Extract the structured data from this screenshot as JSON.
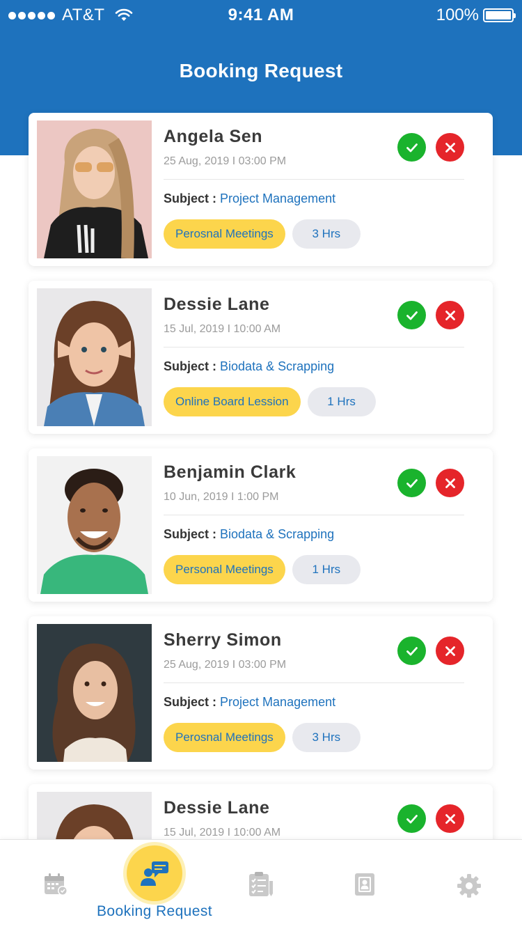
{
  "status_bar": {
    "carrier": "AT&T",
    "time": "9:41 AM",
    "battery": "100%"
  },
  "header": {
    "title": "Booking Request"
  },
  "colors": {
    "primary": "#1e72bd",
    "accept": "#1ab32d",
    "decline": "#e5252a",
    "tag_yellow": "#fcd54c",
    "tag_gray": "#e8e9ee"
  },
  "requests": [
    {
      "name": "Angela Sen",
      "datetime": "25 Aug, 2019 I 03:00 PM",
      "subject_label": "Subject :",
      "subject": "Project Management",
      "type": "Perosnal Meetings",
      "hours": "3 Hrs"
    },
    {
      "name": "Dessie Lane",
      "datetime": "15 Jul, 2019 I 10:00 AM",
      "subject_label": "Subject :",
      "subject": "Biodata & Scrapping",
      "type": "Online Board Lession",
      "hours": "1 Hrs"
    },
    {
      "name": "Benjamin Clark",
      "datetime": "10 Jun, 2019 I 1:00 PM",
      "subject_label": "Subject :",
      "subject": "Biodata & Scrapping",
      "type": "Personal Meetings",
      "hours": "1 Hrs"
    },
    {
      "name": "Sherry Simon",
      "datetime": "25 Aug, 2019 I 03:00 PM",
      "subject_label": "Subject :",
      "subject": "Project Management",
      "type": "Perosnal Meetings",
      "hours": "3 Hrs"
    },
    {
      "name": "Dessie Lane",
      "datetime": "15 Jul, 2019 I 10:00 AM"
    }
  ],
  "tab_bar": {
    "items": [
      {
        "icon": "calendar-icon"
      },
      {
        "icon": "booking-request-icon",
        "label": "Booking Request",
        "active": true
      },
      {
        "icon": "checklist-icon"
      },
      {
        "icon": "contact-book-icon"
      },
      {
        "icon": "gear-icon"
      }
    ]
  }
}
